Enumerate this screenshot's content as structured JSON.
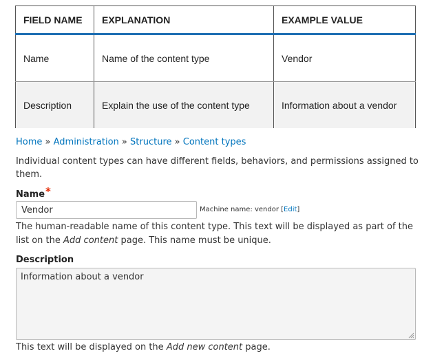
{
  "table": {
    "headers": [
      "FIELD NAME",
      "EXPLANATION",
      "EXAMPLE VALUE"
    ],
    "rows": [
      [
        "Name",
        "Name of the content type",
        "Vendor"
      ],
      [
        "Description",
        "Explain the use of the content type",
        "Information about a vendor"
      ]
    ]
  },
  "breadcrumb": {
    "items": [
      "Home",
      "Administration",
      "Structure",
      "Content types"
    ],
    "separator": "»"
  },
  "intro_text": "Individual content types can have different fields, behaviors, and permissions assigned to them.",
  "name_field": {
    "label": "Name",
    "required_marker": "*",
    "value": "Vendor",
    "machine_name_prefix": "Machine name: vendor",
    "edit_link": "Edit",
    "help_before": "The human-readable name of this content type. This text will be displayed as part of the list on the ",
    "help_em": "Add content",
    "help_after": " page. This name must be unique."
  },
  "description_field": {
    "label": "Description",
    "value": "Information about a vendor",
    "help_before": "This text will be displayed on the ",
    "help_em": "Add new content",
    "help_after": " page."
  },
  "colors": {
    "link": "#0074bd",
    "header_rule": "#1e6fb3",
    "required": "#e32700"
  }
}
